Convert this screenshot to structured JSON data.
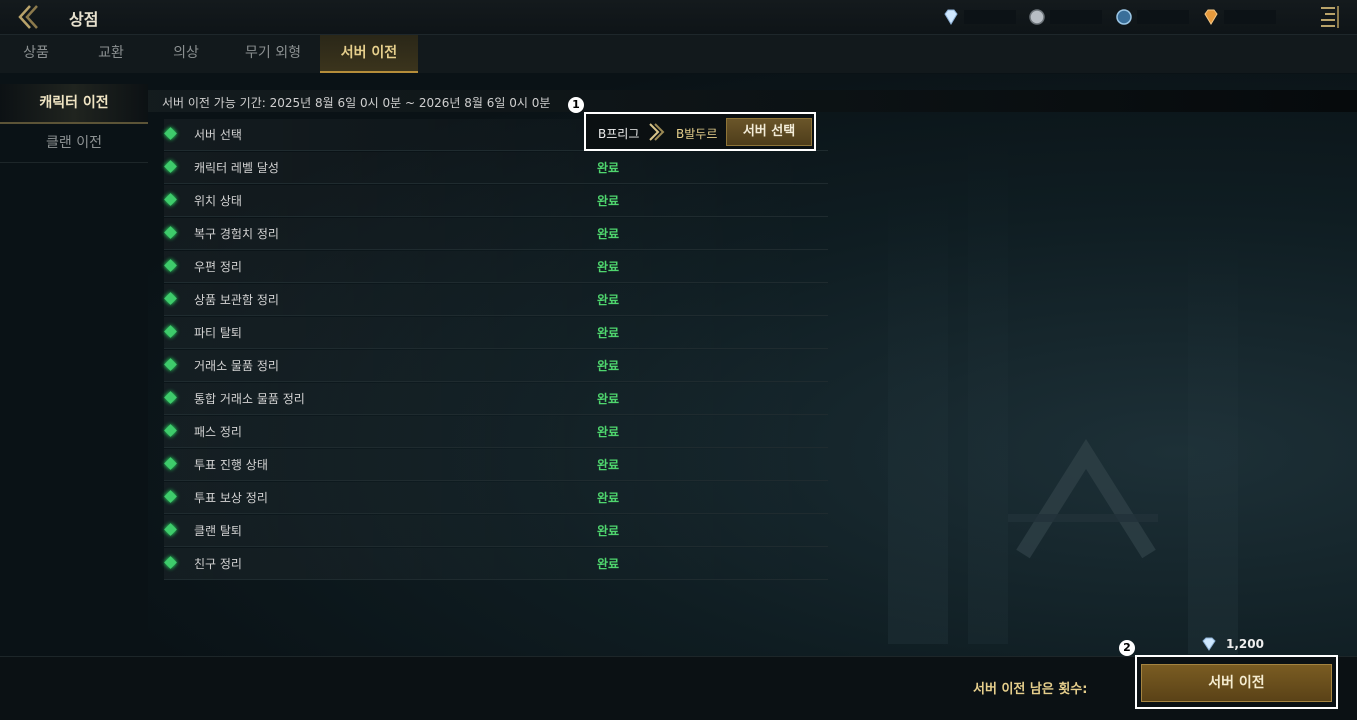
{
  "header": {
    "title": "상점",
    "currencies": [
      {
        "icon": "diamond-icon"
      },
      {
        "icon": "silver-coin-icon"
      },
      {
        "icon": "blue-coin-icon"
      },
      {
        "icon": "orange-gem-icon"
      }
    ]
  },
  "tabs": [
    {
      "label": "상품"
    },
    {
      "label": "교환"
    },
    {
      "label": "의상"
    },
    {
      "label": "무기 외형"
    },
    {
      "label": "서버 이전",
      "active": true
    }
  ],
  "subnav": [
    {
      "label": "캐릭터 이전",
      "active": true
    },
    {
      "label": "클랜 이전"
    }
  ],
  "period_text": "서버 이전 가능 기간: 2025년 8월 6일 0시 0분 ~ 2026년 8월 6일 0시 0분",
  "requirements": [
    {
      "label": "서버 선택",
      "status": ""
    },
    {
      "label": "캐릭터 레벨 달성",
      "status": "완료"
    },
    {
      "label": "위치 상태",
      "status": "완료"
    },
    {
      "label": "복구 경험치 정리",
      "status": "완료"
    },
    {
      "label": "우편 정리",
      "status": "완료"
    },
    {
      "label": "상품 보관함 정리",
      "status": "완료"
    },
    {
      "label": "파티 탈퇴",
      "status": "완료"
    },
    {
      "label": "거래소 물품 정리",
      "status": "완료"
    },
    {
      "label": "통합 거래소 물품 정리",
      "status": "완료"
    },
    {
      "label": "패스 정리",
      "status": "완료"
    },
    {
      "label": "투표 진행 상태",
      "status": "완료"
    },
    {
      "label": "투표 보상 정리",
      "status": "완료"
    },
    {
      "label": "클랜 탈퇴",
      "status": "완료"
    },
    {
      "label": "친구 정리",
      "status": "완료"
    }
  ],
  "server_select": {
    "from": "B프리그",
    "to": "B발두르",
    "button_label": "서버 선택",
    "marker": "1"
  },
  "footer": {
    "remaining_label": "서버 이전 남은 횟수:",
    "cost": "1,200",
    "button_label": "서버 이전",
    "marker": "2"
  },
  "colors": {
    "accent_gold": "#e6cf8c",
    "status_green": "#4fd66e"
  }
}
